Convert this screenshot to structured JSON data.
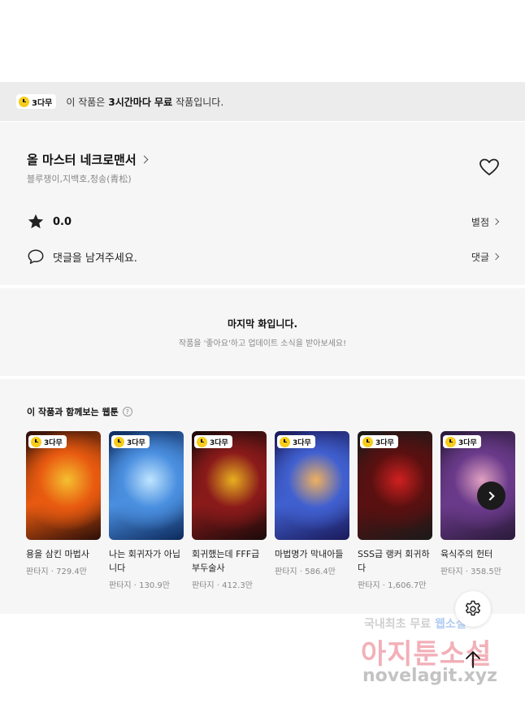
{
  "banner": {
    "badge": "3다무",
    "text_pre": "이 작품은",
    "text_bold": "3시간마다 무료",
    "text_post": "작품입니다."
  },
  "work": {
    "title": "올 마스터 네크로맨서",
    "authors": "블루쟁이,지백호,청송(青松)"
  },
  "rating": {
    "value": "0.0",
    "link": "별점"
  },
  "comment": {
    "prompt": "댓글을 남겨주세요.",
    "link": "댓글"
  },
  "last_episode": {
    "title": "마지막 화입니다.",
    "subtitle": "작품을 '좋아요'하고 업데이트 소식을 받아보세요!"
  },
  "recommend": {
    "heading": "이 작품과 함께보는 웹툰",
    "items": [
      {
        "badge": "3다무",
        "title": "용을 삼킨 마법사",
        "meta": "판타지 · 729.4만",
        "palette": [
          "#2a0e08",
          "#e85a10",
          "#f5c030"
        ]
      },
      {
        "badge": "3다무",
        "title": "나는 회귀자가 아닙니다",
        "meta": "판타지 · 130.9만",
        "palette": [
          "#0d2a5c",
          "#4a8fe0",
          "#bfe4ff"
        ]
      },
      {
        "badge": "3다무",
        "title": "회귀했는데 FFF급 부두술사",
        "meta": "판타지 · 412.3만",
        "palette": [
          "#1a0a0a",
          "#8a1a1a",
          "#e8b020"
        ]
      },
      {
        "badge": "3다무",
        "title": "마법명가 막내아들",
        "meta": "판타지 · 586.4만",
        "palette": [
          "#1a1a5a",
          "#4060d0",
          "#f0b060"
        ]
      },
      {
        "badge": "3다무",
        "title": "SSS급 랭커 회귀하다",
        "meta": "판타지 · 1,606.7만",
        "palette": [
          "#1a1a1a",
          "#5a1010",
          "#d02020"
        ]
      },
      {
        "badge": "3다무",
        "title": "육식주의 헌터",
        "meta": "판타지 · 358.5만",
        "palette": [
          "#2a1a3a",
          "#6a3a8a",
          "#e0a0c0"
        ]
      }
    ]
  },
  "watermark": {
    "line1_pre": "국내최초 무료",
    "line1_accent": "웹소설",
    "line2": "아지툰소설",
    "line3": "novelagit.xyz"
  },
  "icons": {
    "badge": "clock-icon",
    "heart": "heart-icon",
    "star": "star-icon",
    "comment": "speech-bubble-icon",
    "help": "question-icon",
    "next": "chevron-right-icon",
    "settings": "gear-icon",
    "scroll_top": "arrow-up-icon"
  },
  "colors": {
    "badge_clock": "#f7cc1b",
    "info_background": "#f6f6f6",
    "banner_background": "#ececec"
  }
}
